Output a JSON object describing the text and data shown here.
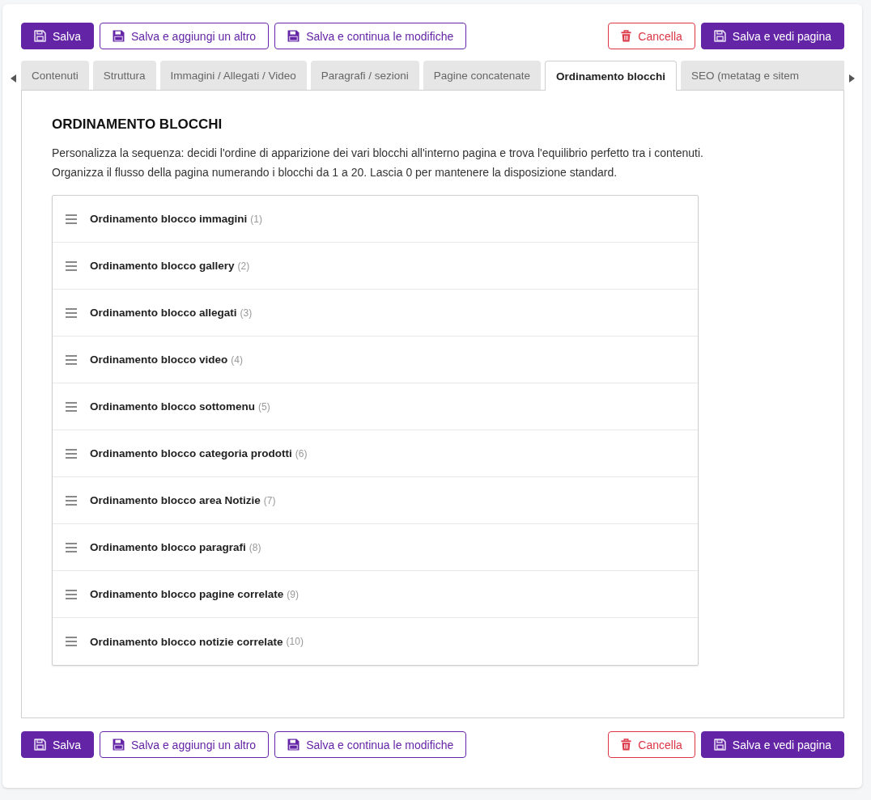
{
  "top_actions": {
    "left": [
      {
        "label": "Salva",
        "kind": "primary"
      },
      {
        "label": "Salva e aggiungi un altro",
        "kind": "outline"
      },
      {
        "label": "Salva e continua le modifiche",
        "kind": "outline"
      }
    ],
    "right": [
      {
        "label": "Cancella",
        "kind": "danger"
      },
      {
        "label": "Salva e vedi pagina",
        "kind": "primary"
      }
    ]
  },
  "tabs": [
    {
      "label": "Contenuti",
      "selected": false
    },
    {
      "label": "Struttura",
      "selected": false
    },
    {
      "label": "Immagini / Allegati / Video",
      "selected": false
    },
    {
      "label": "Paragrafi / sezioni",
      "selected": false
    },
    {
      "label": "Pagine concatenate",
      "selected": false
    },
    {
      "label": "Ordinamento blocchi",
      "selected": true
    },
    {
      "label": "SEO (metatag e sitem",
      "selected": false
    }
  ],
  "panel": {
    "heading": "ORDINAMENTO BLOCCHI",
    "description": [
      "Personalizza la sequenza: decidi l'ordine di apparizione dei vari blocchi all'interno pagina e trova l'equilibrio perfetto tra i contenuti.",
      "Organizza il flusso della pagina numerando i blocchi da 1 a 20. Lascia 0 per mantenere la disposizione standard."
    ],
    "blocks": [
      {
        "label": "Ordinamento blocco immagini",
        "count": "(1)"
      },
      {
        "label": "Ordinamento blocco gallery",
        "count": "(2)"
      },
      {
        "label": "Ordinamento blocco allegati",
        "count": "(3)"
      },
      {
        "label": "Ordinamento blocco video",
        "count": "(4)"
      },
      {
        "label": "Ordinamento blocco sottomenu",
        "count": "(5)"
      },
      {
        "label": "Ordinamento blocco categoria prodotti",
        "count": "(6)"
      },
      {
        "label": "Ordinamento blocco area Notizie",
        "count": "(7)"
      },
      {
        "label": "Ordinamento blocco paragrafi",
        "count": "(8)"
      },
      {
        "label": "Ordinamento blocco pagine correlate",
        "count": "(9)"
      },
      {
        "label": "Ordinamento blocco notizie correlate",
        "count": "(10)"
      }
    ]
  },
  "bottom_actions": {
    "left": [
      {
        "label": "Salva",
        "kind": "primary"
      },
      {
        "label": "Salva e aggiungi un altro",
        "kind": "outline"
      },
      {
        "label": "Salva e continua le modifiche",
        "kind": "outline"
      }
    ],
    "right": [
      {
        "label": "Cancella",
        "kind": "danger"
      },
      {
        "label": "Salva e vedi pagina",
        "kind": "primary"
      }
    ]
  }
}
